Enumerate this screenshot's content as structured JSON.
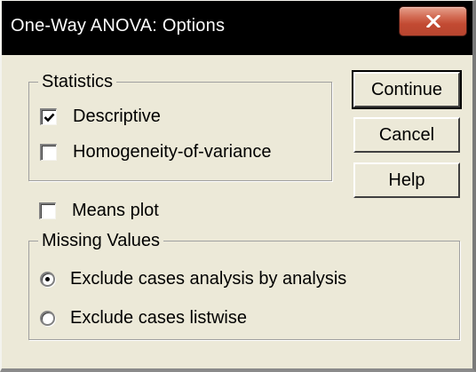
{
  "window": {
    "title": "One-Way ANOVA: Options",
    "close_icon": "close-icon"
  },
  "statistics": {
    "legend": "Statistics",
    "options": [
      {
        "label": "Descriptive",
        "checked": true
      },
      {
        "label": "Homogeneity-of-variance",
        "checked": false
      }
    ]
  },
  "means_plot": {
    "label": "Means plot",
    "checked": false
  },
  "missing_values": {
    "legend": "Missing Values",
    "options": [
      {
        "label": "Exclude cases analysis by analysis",
        "selected": true
      },
      {
        "label": "Exclude cases listwise",
        "selected": false
      }
    ]
  },
  "buttons": {
    "continue_label": "Continue",
    "cancel_label": "Cancel",
    "help_label": "Help"
  },
  "colors": {
    "dialog_bg": "#ece9d8",
    "titlebar_bg": "#000000",
    "close_button": "#c24a32"
  }
}
